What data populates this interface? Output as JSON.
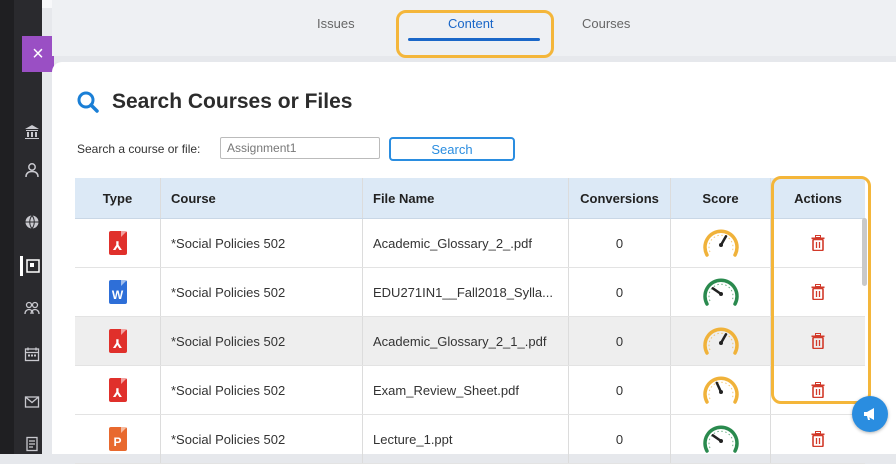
{
  "tabs": [
    {
      "label": "Issues"
    },
    {
      "label": "Content"
    },
    {
      "label": "Courses"
    }
  ],
  "left_nav": {
    "close_label": "×",
    "icons": [
      "institution-icon",
      "user-icon",
      "globe-icon",
      "courses-icon",
      "groups-icon",
      "calendar-icon",
      "messages-icon",
      "grades-icon"
    ]
  },
  "search": {
    "title": "Search Courses or Files",
    "label": "Search a course or file:",
    "value": "Assignment1",
    "button_label": "Search"
  },
  "table": {
    "columns": [
      "Type",
      "Course",
      "File Name",
      "Conversions",
      "Score",
      "Actions"
    ],
    "rows": [
      {
        "type": "pdf",
        "icon_letter": "⅄",
        "course": "*Social Policies 502",
        "file": "Academic_Glossary_2_.pdf",
        "conversions": "0",
        "score_level": "medium"
      },
      {
        "type": "word",
        "icon_letter": "W",
        "course": "*Social Policies 502",
        "file": "EDU271IN1__Fall2018_Sylla...",
        "conversions": "0",
        "score_level": "high"
      },
      {
        "type": "pdf",
        "icon_letter": "⅄",
        "course": "*Social Policies 502",
        "file": "Academic_Glossary_2_1_.pdf",
        "conversions": "0",
        "score_level": "medium"
      },
      {
        "type": "pdf",
        "icon_letter": "⅄",
        "course": "*Social Policies 502",
        "file": "Exam_Review_Sheet.pdf",
        "conversions": "0",
        "score_level": "low"
      },
      {
        "type": "ppt",
        "icon_letter": "P",
        "course": "*Social Policies 502",
        "file": "Lecture_1.ppt",
        "conversions": "0",
        "score_level": "high"
      }
    ]
  },
  "colors": {
    "accent_blue": "#1a67c8",
    "highlight": "#f4b63a",
    "pdf": "#e0302b",
    "word": "#2e6fd8",
    "ppt": "#e8692e",
    "gauge_medium": "#f0b23a",
    "gauge_high": "#2a8a4e",
    "trash": "#d23a2a"
  }
}
